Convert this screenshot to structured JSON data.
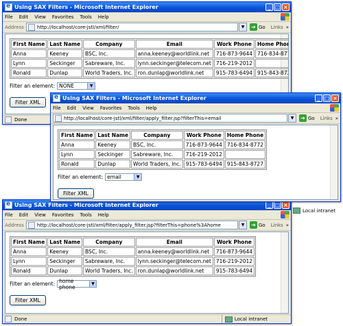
{
  "menu": {
    "file": "File",
    "edit": "Edit",
    "view": "View",
    "favorites": "Favorites",
    "tools": "Tools",
    "help": "Help"
  },
  "toolbar": {
    "address_label": "Address",
    "go_label": "Go",
    "links_label": "Links",
    "more": "»"
  },
  "headers5": [
    "First Name",
    "Last Name",
    "Company",
    "Email",
    "Work Phone",
    "Home Phone"
  ],
  "headers4": [
    "First Name",
    "Last Name",
    "Company",
    "Work Phone",
    "Home Phone"
  ],
  "headers3": [
    "First Name",
    "Last Name",
    "Company",
    "Email",
    "Work Phone"
  ],
  "rows": [
    {
      "first": "Anna",
      "last": "Keeney",
      "company": "BSC, Inc.",
      "email": "anna.keeney@worldlink.net",
      "work": "716-873-9644",
      "home": "716-834-8772"
    },
    {
      "first": "Lynn",
      "last": "Seckinger",
      "company": "Sabreware, Inc.",
      "email": "lynn.seckinger@telecom.net",
      "work": "716-219-2012",
      "home": ""
    },
    {
      "first": "Ronald",
      "last": "Dunlap",
      "company": "World Traders, Inc.",
      "email": "ron.dunlap@worldlink.net",
      "work": "915-783-6494",
      "home": "915-843-8727"
    }
  ],
  "filter_label": "Filter an element:",
  "filter_button": "Filter XML",
  "win1": {
    "title": "Using SAX Filters - Microsoft Internet Explorer",
    "url": "http://localhost/core-jstl/xml/filter/",
    "filter_value": "NONE",
    "status": "Done",
    "zone": ""
  },
  "win2": {
    "title": "Using SAX Filters - Microsoft Internet Explorer",
    "url": "http://localhost/core-jstl/xml/filter/apply_filter.jsp?filterThis=email",
    "filter_value": "email",
    "status": "",
    "zone": "Local intranet"
  },
  "win3": {
    "title": "Using SAX Filters - Microsoft Internet Explorer",
    "url": "http://localhost/core-jstl/xml/filter/apply_filter.jsp?filterThis=phone%3Ahome",
    "filter_value": "home phone",
    "status": "Done",
    "zone": "Local intranet"
  }
}
